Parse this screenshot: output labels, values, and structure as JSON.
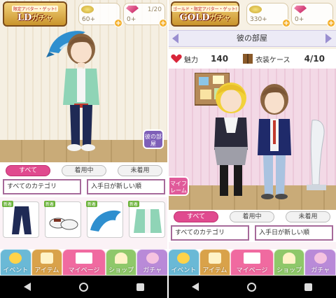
{
  "left": {
    "banner": {
      "sub": "限定アバター・ゲット!",
      "main": "LD",
      "suffix": "ガチャ"
    },
    "currencies": [
      {
        "icon": "coin-icon",
        "value": "60+"
      },
      {
        "icon": "gem-icon",
        "value": "0+"
      }
    ],
    "overlay_text": "1/20",
    "side_button": "彼の部屋",
    "tabs": [
      "すべて",
      "着用中",
      "未着用"
    ],
    "active_tab": "すべて",
    "selects": [
      "すべてのカテゴリ",
      "入手日が新しい順"
    ],
    "items": [
      {
        "tag": "新着",
        "icon": "pants-icon"
      },
      {
        "tag": "新着",
        "icon": "shoes-icon"
      },
      {
        "tag": "新着",
        "icon": "dolphin-icon"
      },
      {
        "tag": "新着",
        "icon": "jacket-icon"
      }
    ]
  },
  "right": {
    "banner": {
      "sub": "ゴールド・限定アバター・ゲット!",
      "main": "GOLD",
      "suffix": "ガチャ"
    },
    "currencies": [
      {
        "icon": "coin-icon",
        "value": "330+"
      },
      {
        "icon": "gem-icon",
        "value": "0+"
      }
    ],
    "room_title": "彼の部屋",
    "stats": {
      "charm_label": "魅力",
      "charm_value": "140",
      "wardrobe_label": "衣装ケース",
      "wardrobe_value": "4/10"
    },
    "side_button": "マイフレーム",
    "tabs": [
      "すべて",
      "着用中",
      "未着用"
    ],
    "active_tab": "すべて",
    "selects": [
      "すべてのカテゴリ",
      "入手日が新しい順"
    ]
  },
  "nav": [
    "イベント",
    "アイテム",
    "マイページ",
    "ショップ",
    "ガチャ"
  ],
  "colors": {
    "accent_pink": "#e04a8f",
    "purple_border": "#a66a9a"
  }
}
